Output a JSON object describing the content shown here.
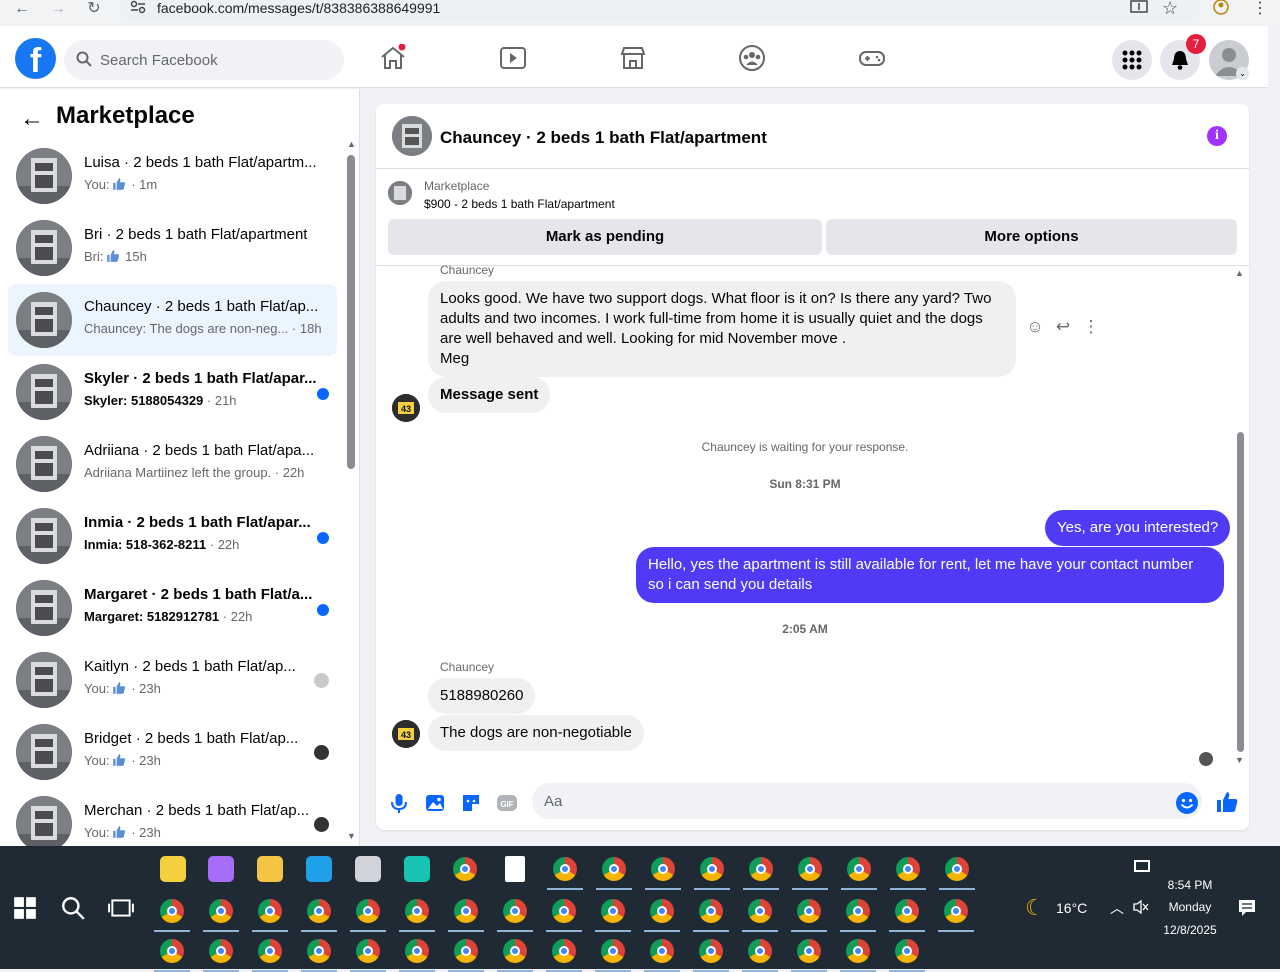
{
  "browser": {
    "url": "facebook.com/messages/t/838386388649991"
  },
  "topbar": {
    "logo": "f",
    "search_placeholder": "Search Facebook",
    "notification_count": "7"
  },
  "sidebar": {
    "title": "Marketplace",
    "conversations": [
      {
        "name": "Luisa · 2 beds 1 bath Flat/apartm...",
        "prefix": "You:",
        "preview": "",
        "time": "· 1m",
        "like": true,
        "unread": false
      },
      {
        "name": "Bri · 2 beds 1 bath Flat/apartment",
        "prefix": "Bri:",
        "preview": "",
        "time": "15h",
        "like": true,
        "unread": false
      },
      {
        "name": "Chauncey · 2 beds 1 bath Flat/ap...",
        "prefix": "",
        "preview": "Chauncey: The dogs are non-neg...",
        "time": "· 18h",
        "like": false,
        "unread": false
      },
      {
        "name": "Skyler · 2 beds 1 bath Flat/apar...",
        "prefix": "",
        "preview": "Skyler: 5188054329",
        "time": "· 21h",
        "like": false,
        "unread": true
      },
      {
        "name": "Adriiana · 2 beds 1 bath Flat/apa...",
        "prefix": "",
        "preview": "Adriiana Martiinez left the group.",
        "time": "· 22h",
        "like": false,
        "unread": false
      },
      {
        "name": "Inmia · 2 beds 1 bath Flat/apar...",
        "prefix": "",
        "preview": "Inmia: 518-362-8211",
        "time": "· 22h",
        "like": false,
        "unread": true
      },
      {
        "name": "Margaret · 2 beds 1 bath Flat/a...",
        "prefix": "",
        "preview": "Margaret: 5182912781",
        "time": "· 22h",
        "like": false,
        "unread": true
      },
      {
        "name": "Kaitlyn · 2 beds 1 bath Flat/ap...",
        "prefix": "You:",
        "preview": "",
        "time": "· 23h",
        "like": true,
        "unread": false
      },
      {
        "name": "Bridget · 2 beds 1 bath Flat/ap...",
        "prefix": "You:",
        "preview": "",
        "time": "· 23h",
        "like": true,
        "unread": false
      },
      {
        "name": "Merchan · 2 beds 1 bath Flat/ap...",
        "prefix": "You:",
        "preview": "",
        "time": "· 23h",
        "like": true,
        "unread": false
      }
    ]
  },
  "chat": {
    "title": "Chauncey · 2 beds 1 bath Flat/apartment",
    "listing_source": "Marketplace",
    "listing_price": "$900 - 2 beds 1 bath Flat/apartment",
    "btn_pending": "Mark as pending",
    "btn_more": "More options",
    "sender_top": "Chauncey",
    "msg1": "Looks good.  We have two support dogs.  What floor is it on? Is there any yard?  Two adults and two incomes.   I work full-time from home it is usually quiet and the dogs are well behaved and well.  Looking for mid November move .",
    "msg1_sign": "Meg",
    "msg2": "Message sent",
    "waiting": "Chauncey is waiting for your response.",
    "time1": "Sun 8:31 PM",
    "out1": "Yes, are you interested?",
    "out2": "Hello, yes the apartment is still available for rent, let me have your contact number so i can send you details",
    "time2": "2:05 AM",
    "sender_bottom": "Chauncey",
    "msg3": "5188980260",
    "msg4": "The  dogs are non-negotiable",
    "composer_placeholder": "Aa"
  },
  "taskbar": {
    "weather": "16°C",
    "time": "8:54 PM",
    "day": "Monday",
    "date": "12/8/2025"
  }
}
